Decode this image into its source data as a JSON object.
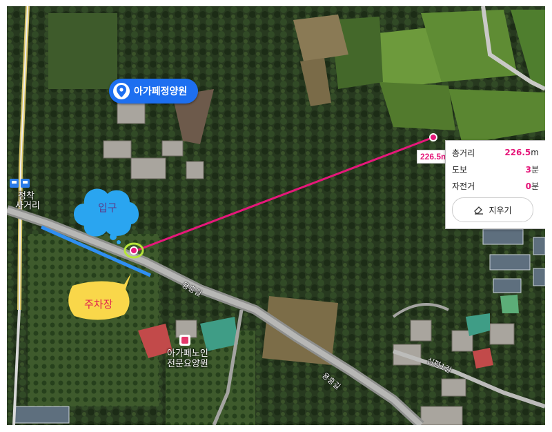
{
  "place_label": {
    "name": "아가페정양원",
    "icon": "location-pin-icon",
    "color": "#1d6ff0"
  },
  "annotations": {
    "entrance": "입구",
    "parking": "주차장"
  },
  "pois": {
    "bus_stop_line1": "정착",
    "bus_stop_line2": "사거리",
    "nursing_home_line1": "아가페노인",
    "nursing_home_line2": "전문요양원"
  },
  "roads": [
    "용흥길",
    "용흥길",
    "신평1길"
  ],
  "route": {
    "distance_tag": "226.5m",
    "color": "#e5177a"
  },
  "distance_panel": {
    "total_label": "총거리",
    "total_value": "226.5",
    "total_unit": "m",
    "walk_label": "도보",
    "walk_value": "3",
    "walk_unit": "분",
    "bike_label": "자전거",
    "bike_value": "0",
    "bike_unit": "분",
    "erase_button": "지우기",
    "erase_icon": "eraser-icon"
  },
  "colors": {
    "entrance_bubble": "#2aa5f0",
    "parking_bubble": "#f9d74a",
    "parking_text": "#e0224f",
    "entrance_text": "#5a3b8a",
    "parking_line": "#2f8ff2"
  }
}
